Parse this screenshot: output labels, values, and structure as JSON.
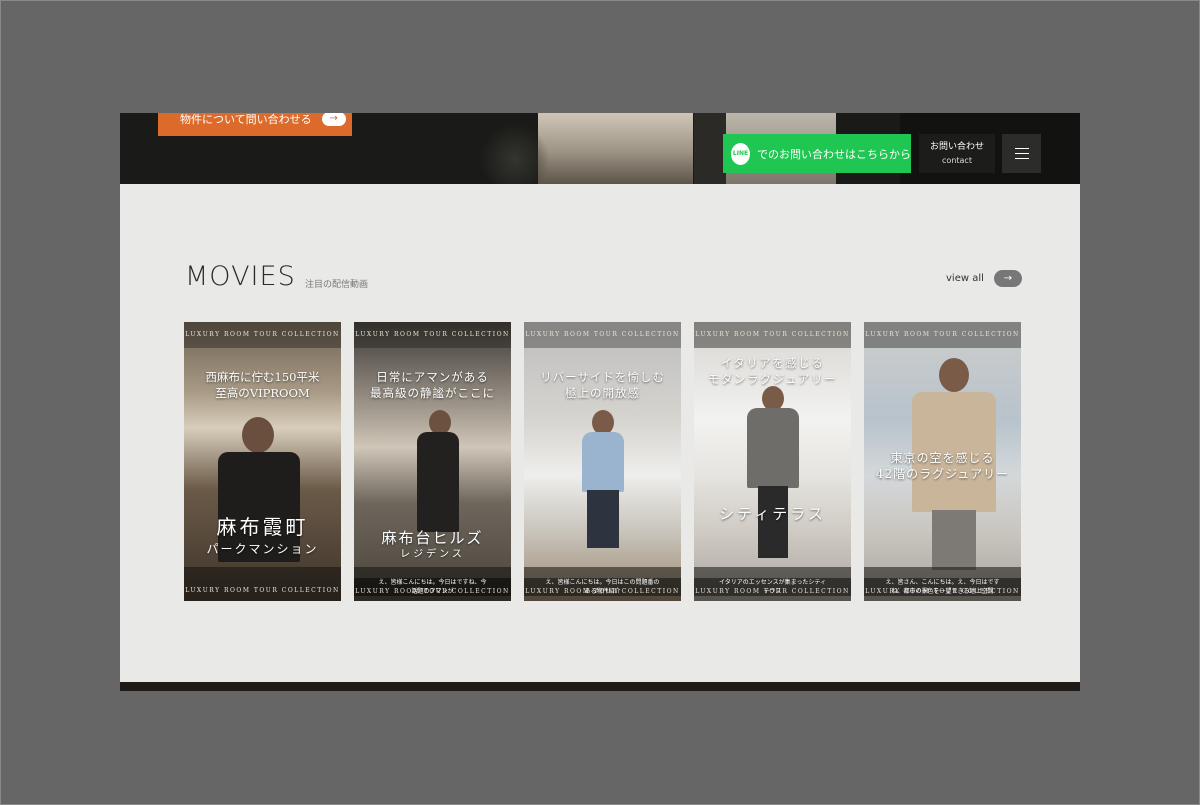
{
  "hero": {
    "cta_label": "物件について問い合わせる",
    "cta_arrow": "→"
  },
  "header": {
    "line_logo": "LINE",
    "line_label": "でのお問い合わせはこちらから",
    "contact_label": "お問い合わせ",
    "contact_sub": "contact"
  },
  "movies": {
    "title": "MOVIES",
    "subtitle": "注目の配信動画",
    "view_all": "view all",
    "view_all_arrow": "→",
    "cards": [
      {
        "collection": "LUXURY ROOM TOUR COLLECTION",
        "headline1": "西麻布に佇む150平米",
        "headline2": "至高のVIPROOM",
        "name1": "麻布霞町",
        "name2": "パークマンション",
        "caption1": "",
        "caption2": ""
      },
      {
        "collection": "LUXURY ROOM TOUR COLLECTION",
        "headline1": "日常にアマンがある",
        "headline2": "最高級の静謐がここに",
        "name1": "麻布台ヒルズ",
        "name2": "レジデンス",
        "caption1": "え、皆様こんにちは。今日はですね、今",
        "caption2": "話題のアマンが"
      },
      {
        "collection": "LUXURY ROOM TOUR COLLECTION",
        "headline1": "リバーサイドを愉しむ",
        "headline2": "極上の開放感",
        "name1": "",
        "name2": "",
        "caption1": "え、皆様こんにちは。今日はこの問題番の",
        "caption2": "ある物件紹介"
      },
      {
        "collection": "LUXURY ROOM TOUR COLLECTION",
        "headline1": "イタリアを感じる",
        "headline2": "モダンラグジュアリー",
        "name1": "シティテラス",
        "name2": "",
        "caption1": "イタリアのエッセンスが集まったシティ",
        "caption2": "テラス"
      },
      {
        "collection": "LUXURY ROOM TOUR COLLECTION",
        "headline1": "東京の空を感じる",
        "headline2": "42階のラグジュアリー",
        "name1": "",
        "name2": "",
        "caption1": "え、皆さん、こんにちは。え、今日はです",
        "caption2": "ね、都市の景色を一望できる地上空間"
      }
    ]
  },
  "colors": {
    "accent_orange": "#dc6a2b",
    "line_green": "#1fc651",
    "section_bg": "#e9e9e7",
    "outer_bg": "#666666"
  }
}
